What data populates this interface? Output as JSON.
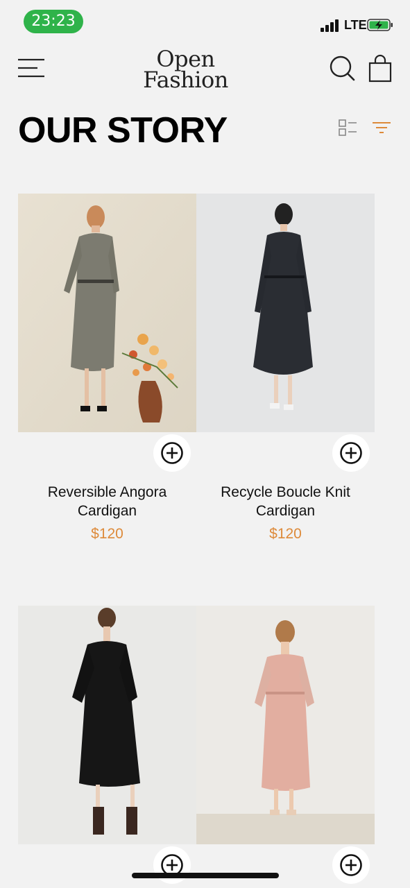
{
  "status_bar": {
    "time": "23:23",
    "network": "LTE"
  },
  "header": {
    "logo_line1": "Open",
    "logo_line2": "Fashion",
    "menu_icon": "hamburger-menu-icon",
    "search_icon": "search-icon",
    "bag_icon": "shopping-bag-icon"
  },
  "page": {
    "title": "OUR STORY"
  },
  "products": [
    {
      "name_line1": "Reversible Angora",
      "name_line2": "Cardigan",
      "price": "$120"
    },
    {
      "name_line1": "Recycle Boucle Knit",
      "name_line2": "Cardigan",
      "price": "$120"
    },
    {
      "name_line1": "",
      "name_line2": "",
      "price": ""
    },
    {
      "name_line1": "",
      "name_line2": "",
      "price": ""
    }
  ],
  "colors": {
    "accent": "#dd8a3a",
    "status_pill": "#2fb34a",
    "background": "#f2f2f2"
  }
}
